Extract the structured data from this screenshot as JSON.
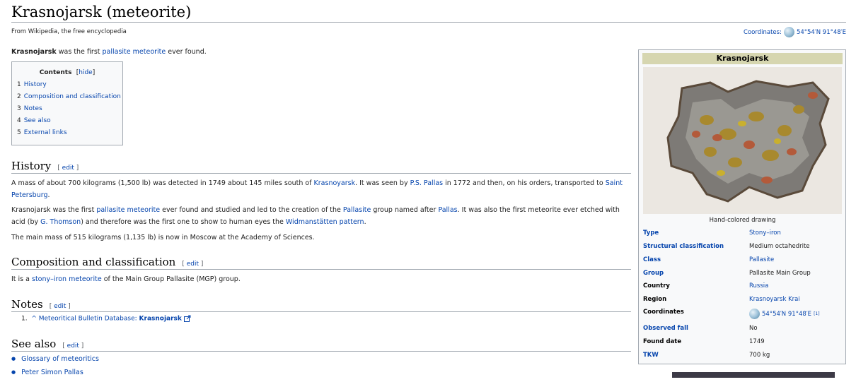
{
  "title": "Krasnojarsk (meteorite)",
  "tagline": "From Wikipedia, the free encyclopedia",
  "coordinates": {
    "label": "Coordinates:",
    "value": "54°54′N 91°48′E"
  },
  "intro": {
    "bold": "Krasnojarsk",
    "text1": " was the first ",
    "link": "pallasite meteorite",
    "text2": " ever found."
  },
  "toc": {
    "title": "Contents",
    "hide": "hide",
    "items": [
      {
        "num": "1",
        "label": "History"
      },
      {
        "num": "2",
        "label": "Composition and classification"
      },
      {
        "num": "3",
        "label": "Notes"
      },
      {
        "num": "4",
        "label": "See also"
      },
      {
        "num": "5",
        "label": "External links"
      }
    ]
  },
  "edit_label": "edit",
  "sections": {
    "history": {
      "heading": "History",
      "p1": {
        "t1": "A mass of about 700 kilograms (1,500 lb) was detected in 1749 about 145 miles south of ",
        "l1": "Krasnoyarsk",
        "t2": ". It was seen by ",
        "l2": "P.S. Pallas",
        "t3": " in 1772 and then, on his orders, transported to ",
        "l3": "Saint Petersburg",
        "t4": "."
      },
      "p2": {
        "t1": "Krasnojarsk was the first ",
        "l1": "pallasite meteorite",
        "t2": " ever found and studied and led to the creation of the ",
        "l2": "Pallasite",
        "t3": " group named after ",
        "l3": "Pallas",
        "t4": ". It was also the first meteorite ever etched with acid (by ",
        "l4": "G. Thomson",
        "t5": ") and therefore was the first one to show to human eyes the ",
        "l5": "Widmanstätten pattern",
        "t6": "."
      },
      "p3": "The main mass of 515 kilograms (1,135 lb) is now in Moscow at the Academy of Sciences."
    },
    "composition": {
      "heading": "Composition and classification",
      "p1": {
        "t1": "It is a ",
        "l1": "stony–iron meteorite",
        "t2": " of the Main Group Pallasite (MGP) group."
      }
    },
    "notes": {
      "heading": "Notes",
      "ref": {
        "num": "1.",
        "caret": "^",
        "text": "Meteoritical Bulletin Database: ",
        "bold": "Krasnojarsk"
      }
    },
    "see_also": {
      "heading": "See also",
      "items": [
        "Glossary of meteoritics",
        "Peter Simon Pallas"
      ]
    }
  },
  "infobox": {
    "title": "Krasnojarsk",
    "caption": "Hand-colored drawing",
    "rows": [
      {
        "label": "Type",
        "value": "Stony–iron",
        "label_link": true,
        "value_link": true
      },
      {
        "label": "Structural classification",
        "value": "Medium octahedrite",
        "label_link": true,
        "value_link": false
      },
      {
        "label": "Class",
        "value": "Pallasite",
        "label_link": true,
        "value_link": true
      },
      {
        "label": "Group",
        "value": "Pallasite Main Group",
        "label_link": true,
        "value_link": false
      },
      {
        "label": "Country",
        "value": "Russia",
        "label_link": false,
        "value_link": true
      },
      {
        "label": "Region",
        "value": "Krasnoyarsk Krai",
        "label_link": false,
        "value_link": true
      },
      {
        "label": "Coordinates",
        "value": "54°54′N 91°48′E",
        "sup": "[1]",
        "label_link": false,
        "value_link": true
      },
      {
        "label": "Observed fall",
        "value": "No",
        "label_link": true,
        "value_link": false
      },
      {
        "label": "Found date",
        "value": "1749",
        "label_link": false,
        "value_link": false
      },
      {
        "label": "TKW",
        "value": "700 kg",
        "label_link": true,
        "value_link": false
      }
    ]
  }
}
